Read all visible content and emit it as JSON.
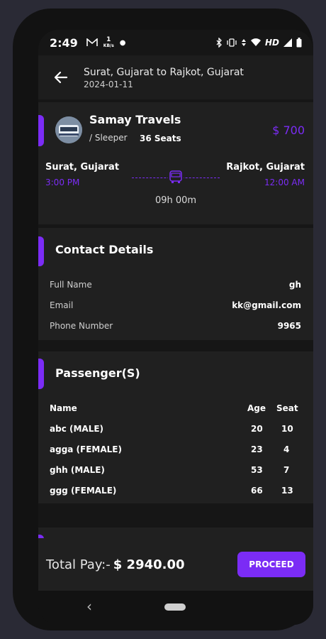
{
  "status_bar": {
    "time": "2:49",
    "network_speed": "1",
    "network_unit": "KB/s",
    "hd": "HD",
    "icons": [
      "gmail-icon",
      "bluetooth-icon",
      "vibrate-icon",
      "data-icon",
      "wifi-icon",
      "signal-icon",
      "battery-icon"
    ]
  },
  "header": {
    "route": "Surat, Gujarat  to  Rajkot, Gujarat",
    "date": "2024-01-11"
  },
  "trip": {
    "operator": "Samay Travels",
    "bus_type": "/ Sleeper",
    "seats": "36 Seats",
    "price": "$ 700",
    "from_city": "Surat, Gujarat",
    "from_time": "3:00 PM",
    "to_city": "Rajkot, Gujarat",
    "to_time": "12:00 AM",
    "duration": "09h 00m"
  },
  "contact": {
    "title": "Contact Details",
    "rows": [
      {
        "label": "Full Name",
        "value": "gh"
      },
      {
        "label": "Email",
        "value": "kk@gmail.com"
      },
      {
        "label": "Phone Number",
        "value": "9965"
      }
    ]
  },
  "passengers": {
    "title": "Passenger(S)",
    "headers": {
      "name": "Name",
      "age": "Age",
      "seat": "Seat"
    },
    "rows": [
      {
        "name": "abc (MALE)",
        "age": "20",
        "seat": "10"
      },
      {
        "name": "agga (FEMALE)",
        "age": "23",
        "seat": "4"
      },
      {
        "name": "ghh (MALE)",
        "age": "53",
        "seat": "7"
      },
      {
        "name": "ggg (FEMALE)",
        "age": "66",
        "seat": "13"
      }
    ]
  },
  "footer": {
    "total_label": "Total Pay:-",
    "total_amount": "$ 2940.00",
    "proceed": "PROCEED"
  },
  "colors": {
    "accent": "#7b2cf5",
    "background": "#161616",
    "card": "#202020"
  }
}
